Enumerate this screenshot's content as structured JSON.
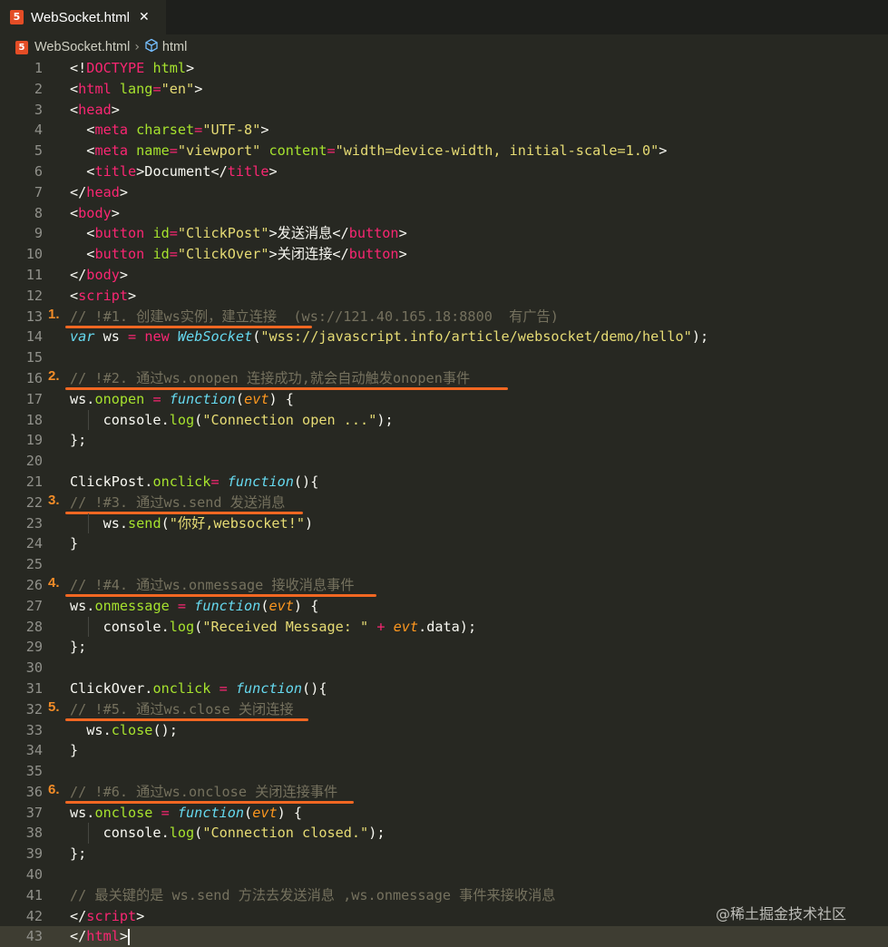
{
  "tab": {
    "icon": "5",
    "title": "WebSocket.html",
    "close": "✕"
  },
  "breadcrumb": {
    "file": "WebSocket.html",
    "sep": "›",
    "node": "html"
  },
  "lines": [
    {
      "n": "1",
      "tokens": [
        [
          "",
          "<!"
        ],
        [
          "t",
          "DOCTYPE"
        ],
        [
          "a",
          " html"
        ],
        [
          "",
          ">"
        ]
      ]
    },
    {
      "n": "2",
      "tokens": [
        [
          "",
          "<"
        ],
        [
          "t",
          "html"
        ],
        [
          "a",
          " lang"
        ],
        [
          "t",
          "="
        ],
        [
          "s",
          "\"en\""
        ],
        [
          "",
          ">"
        ]
      ]
    },
    {
      "n": "3",
      "tokens": [
        [
          "",
          "<"
        ],
        [
          "t",
          "head"
        ],
        [
          "",
          ">"
        ]
      ]
    },
    {
      "n": "4",
      "tokens": [
        [
          "",
          "  <"
        ],
        [
          "t",
          "meta"
        ],
        [
          "a",
          " charset"
        ],
        [
          "t",
          "="
        ],
        [
          "s",
          "\"UTF-8\""
        ],
        [
          "",
          ">"
        ]
      ]
    },
    {
      "n": "5",
      "tokens": [
        [
          "",
          "  <"
        ],
        [
          "t",
          "meta"
        ],
        [
          "a",
          " name"
        ],
        [
          "t",
          "="
        ],
        [
          "s",
          "\"viewport\""
        ],
        [
          "a",
          " content"
        ],
        [
          "t",
          "="
        ],
        [
          "s",
          "\"width=device-width, initial-scale=1.0\""
        ],
        [
          "",
          ">"
        ]
      ]
    },
    {
      "n": "6",
      "tokens": [
        [
          "",
          "  <"
        ],
        [
          "t",
          "title"
        ],
        [
          "",
          ">Document</"
        ],
        [
          "t",
          "title"
        ],
        [
          "",
          ">"
        ]
      ]
    },
    {
      "n": "7",
      "tokens": [
        [
          "",
          "</"
        ],
        [
          "t",
          "head"
        ],
        [
          "",
          ">"
        ]
      ]
    },
    {
      "n": "8",
      "tokens": [
        [
          "",
          "<"
        ],
        [
          "t",
          "body"
        ],
        [
          "",
          ">"
        ]
      ]
    },
    {
      "n": "9",
      "tokens": [
        [
          "",
          "  <"
        ],
        [
          "t",
          "button"
        ],
        [
          "a",
          " id"
        ],
        [
          "t",
          "="
        ],
        [
          "s",
          "\"ClickPost\""
        ],
        [
          "",
          ">发送消息</"
        ],
        [
          "t",
          "button"
        ],
        [
          "",
          ">"
        ]
      ]
    },
    {
      "n": "10",
      "tokens": [
        [
          "",
          "  <"
        ],
        [
          "t",
          "button"
        ],
        [
          "a",
          " id"
        ],
        [
          "t",
          "="
        ],
        [
          "s",
          "\"ClickOver\""
        ],
        [
          "",
          ">关闭连接</"
        ],
        [
          "t",
          "button"
        ],
        [
          "",
          ">"
        ]
      ]
    },
    {
      "n": "11",
      "tokens": [
        [
          "",
          "</"
        ],
        [
          "t",
          "body"
        ],
        [
          "",
          ">"
        ]
      ]
    },
    {
      "n": "12",
      "tokens": [
        [
          "",
          "<"
        ],
        [
          "t",
          "script"
        ],
        [
          "",
          ">"
        ]
      ]
    },
    {
      "n": "13",
      "ann": "1.",
      "ul": 272,
      "tokens": [
        [
          "c",
          "// !#1. 创建ws实例，建立连接  (ws://121.40.165.18:8800  有广告)"
        ]
      ]
    },
    {
      "n": "14",
      "tokens": [
        [
          "k",
          "var"
        ],
        [
          "",
          " ws "
        ],
        [
          "t",
          "="
        ],
        [
          "t",
          " new"
        ],
        [
          "k",
          " WebSocket"
        ],
        [
          "",
          "("
        ],
        [
          "s",
          "\"wss://javascript.info/article/websocket/demo/hello\""
        ],
        [
          "",
          ");"
        ]
      ]
    },
    {
      "n": "15",
      "tokens": []
    },
    {
      "n": "16",
      "ann": "2.",
      "ul": 488,
      "tokens": [
        [
          "c",
          "// !#2. 通过ws.onopen 连接成功,就会自动触发onopen事件"
        ]
      ]
    },
    {
      "n": "17",
      "tokens": [
        [
          "",
          "ws."
        ],
        [
          "a",
          "onopen"
        ],
        [
          "t",
          " ="
        ],
        [
          "k",
          " function"
        ],
        [
          "",
          "("
        ],
        [
          "p",
          "evt"
        ],
        [
          "",
          ") {"
        ]
      ]
    },
    {
      "n": "18",
      "guide": true,
      "tokens": [
        [
          "",
          "    console."
        ],
        [
          "a",
          "log"
        ],
        [
          "",
          "("
        ],
        [
          "s",
          "\"Connection open ...\""
        ],
        [
          "",
          ");"
        ]
      ]
    },
    {
      "n": "19",
      "tokens": [
        [
          "",
          "};"
        ]
      ]
    },
    {
      "n": "20",
      "tokens": []
    },
    {
      "n": "21",
      "tokens": [
        [
          "",
          "ClickPost."
        ],
        [
          "a",
          "onclick"
        ],
        [
          "t",
          "="
        ],
        [
          "k",
          " function"
        ],
        [
          "",
          "(){"
        ]
      ]
    },
    {
      "n": "22",
      "ann": "3.",
      "ul": 262,
      "tokens": [
        [
          "c",
          "// !#3. 通过ws.send 发送消息"
        ]
      ]
    },
    {
      "n": "23",
      "guide": true,
      "tokens": [
        [
          "",
          "    ws."
        ],
        [
          "a",
          "send"
        ],
        [
          "",
          "("
        ],
        [
          "s",
          "\"你好,websocket!\""
        ],
        [
          "",
          ")"
        ]
      ]
    },
    {
      "n": "24",
      "tokens": [
        [
          "",
          "}"
        ]
      ]
    },
    {
      "n": "25",
      "tokens": []
    },
    {
      "n": "26",
      "ann": "4.",
      "ul": 343,
      "tokens": [
        [
          "c",
          "// !#4. 通过ws.onmessage 接收消息事件"
        ]
      ]
    },
    {
      "n": "27",
      "tokens": [
        [
          "",
          "ws."
        ],
        [
          "a",
          "onmessage"
        ],
        [
          "t",
          " ="
        ],
        [
          "k",
          " function"
        ],
        [
          "",
          "("
        ],
        [
          "p",
          "evt"
        ],
        [
          "",
          ") {"
        ]
      ]
    },
    {
      "n": "28",
      "guide": true,
      "tokens": [
        [
          "",
          "    console."
        ],
        [
          "a",
          "log"
        ],
        [
          "",
          "("
        ],
        [
          "s",
          "\"Received Message: \""
        ],
        [
          "t",
          " +"
        ],
        [
          "p",
          " evt"
        ],
        [
          "",
          ".data);"
        ]
      ]
    },
    {
      "n": "29",
      "tokens": [
        [
          "",
          "};"
        ]
      ]
    },
    {
      "n": "30",
      "tokens": []
    },
    {
      "n": "31",
      "tokens": [
        [
          "",
          "ClickOver."
        ],
        [
          "a",
          "onclick"
        ],
        [
          "t",
          " ="
        ],
        [
          "k",
          " function"
        ],
        [
          "",
          "(){"
        ]
      ]
    },
    {
      "n": "32",
      "ann": "5.",
      "ul": 268,
      "tokens": [
        [
          "c",
          "// !#5. 通过ws.close 关闭连接"
        ]
      ]
    },
    {
      "n": "33",
      "tokens": [
        [
          "",
          "  ws."
        ],
        [
          "a",
          "close"
        ],
        [
          "",
          "();"
        ]
      ]
    },
    {
      "n": "34",
      "tokens": [
        [
          "",
          "}"
        ]
      ]
    },
    {
      "n": "35",
      "tokens": []
    },
    {
      "n": "36",
      "ann": "6.",
      "ul": 318,
      "tokens": [
        [
          "c",
          "// !#6. 通过ws.onclose 关闭连接事件"
        ]
      ]
    },
    {
      "n": "37",
      "tokens": [
        [
          "",
          "ws."
        ],
        [
          "a",
          "onclose"
        ],
        [
          "t",
          " ="
        ],
        [
          "k",
          " function"
        ],
        [
          "",
          "("
        ],
        [
          "p",
          "evt"
        ],
        [
          "",
          ") {"
        ]
      ]
    },
    {
      "n": "38",
      "guide": true,
      "tokens": [
        [
          "",
          "    console."
        ],
        [
          "a",
          "log"
        ],
        [
          "",
          "("
        ],
        [
          "s",
          "\"Connection closed.\""
        ],
        [
          "",
          ");"
        ]
      ]
    },
    {
      "n": "39",
      "tokens": [
        [
          "",
          "};"
        ]
      ]
    },
    {
      "n": "40",
      "tokens": []
    },
    {
      "n": "41",
      "tokens": [
        [
          "c",
          "// 最关键的是 ws.send 方法去发送消息 ,ws.onmessage 事件来接收消息"
        ]
      ]
    },
    {
      "n": "42",
      "tokens": [
        [
          "",
          "</"
        ],
        [
          "t",
          "script"
        ],
        [
          "",
          ">"
        ]
      ]
    },
    {
      "n": "43",
      "cur": true,
      "tokens": [
        [
          "",
          "</"
        ],
        [
          "t",
          "html"
        ],
        [
          "",
          ">"
        ]
      ]
    }
  ],
  "watermark": "@稀土掘金技术社区"
}
